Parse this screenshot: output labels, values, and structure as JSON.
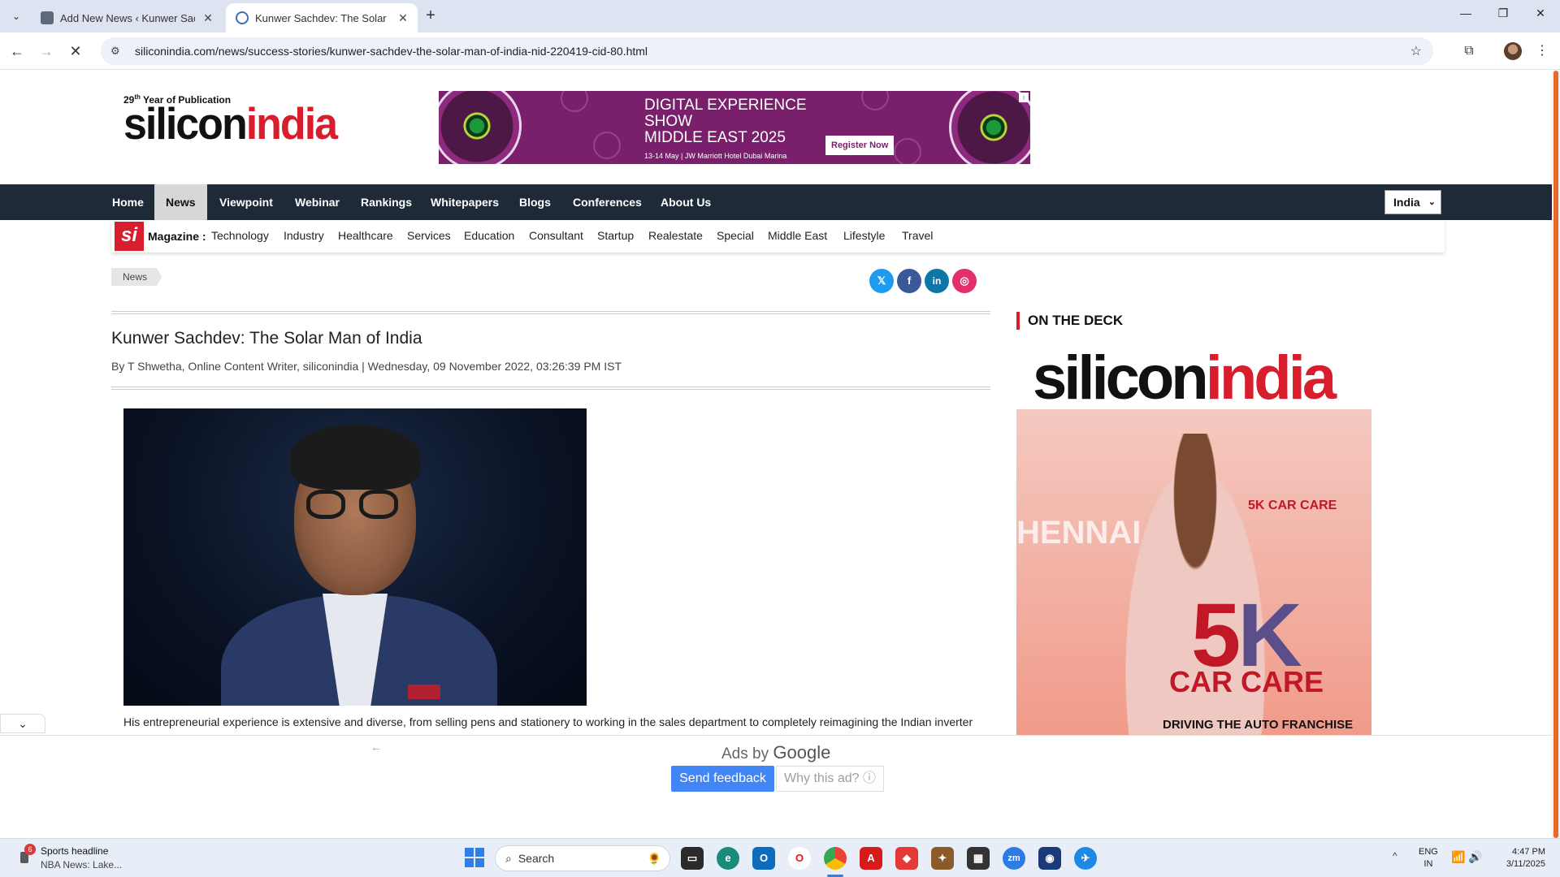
{
  "browser": {
    "tabs": [
      {
        "title": "Add New News ‹ Kunwer Sachdev",
        "active": false
      },
      {
        "title": "Kunwer Sachdev: The Solar Man of India",
        "active": true
      }
    ],
    "url": "siliconindia.com/news/success-stories/kunwer-sachdev-the-solar-man-of-india-nid-220419-cid-80.html"
  },
  "site": {
    "logo_tagline_ordinal": "29",
    "logo_tagline_suffix": "th",
    "logo_tagline_rest": " Year of Publication",
    "logo_part1": "silicon",
    "logo_part2": "india",
    "ad_banner": {
      "headline_1": "DIGITAL EXPERIENCE",
      "headline_2": "SHOW",
      "headline_3": "MIDDLE EAST 2025",
      "sub": "13-14 May | JW Marriott Hotel Dubai Marina",
      "button": "Register Now"
    },
    "main_nav": [
      "Home",
      "News",
      "Viewpoint",
      "Webinar",
      "Rankings",
      "Whitepapers",
      "Blogs",
      "Conferences",
      "About Us"
    ],
    "main_nav_active": "News",
    "region": "India",
    "magazine_badge": "si",
    "magazine_label": "Magazine :",
    "magazine_nav": [
      "Technology",
      "Industry",
      "Healthcare",
      "Services",
      "Education",
      "Consultant",
      "Startup",
      "Realestate",
      "Special",
      "Middle East",
      "Lifestyle",
      "Travel"
    ],
    "breadcrumb": "News"
  },
  "article": {
    "title": "Kunwer Sachdev: The Solar Man of India",
    "byline": "By T Shwetha, Online Content Writer, siliconindia  |  Wednesday, 09 November 2022, 03:26:39 PM IST",
    "first_line": "His entrepreneurial experience is extensive and diverse, from selling pens and stationery to working in the sales department to completely reimagining the Indian inverter"
  },
  "sidebar": {
    "deck_title": "ON THE DECK",
    "cover": {
      "mast_1": "silicon",
      "mast_2": "india",
      "big_1": "5",
      "big_2": "K",
      "car_care": "CAR CARE",
      "tagline": "DRIVING THE AUTO FRANCHISE",
      "side_text": "HENNAI",
      "brand": "5K CAR CARE"
    }
  },
  "ads_panel": {
    "ads_by": "Ads by ",
    "google": "Google",
    "send_feedback": "Send feedback",
    "why_this_ad": "Why this ad? ⓘ"
  },
  "taskbar": {
    "news_badge": "6",
    "news_title": "Sports headline",
    "news_sub": "NBA News: Lake...",
    "search_placeholder": "Search",
    "lang_1": "ENG",
    "lang_2": "IN",
    "time": "4:47 PM",
    "date": "3/11/2025"
  },
  "colors": {
    "brand_red": "#d81e2c",
    "nav_dark": "#1f2a38",
    "ad_purple": "#7a1f6b",
    "google_blue": "#4285f4"
  }
}
